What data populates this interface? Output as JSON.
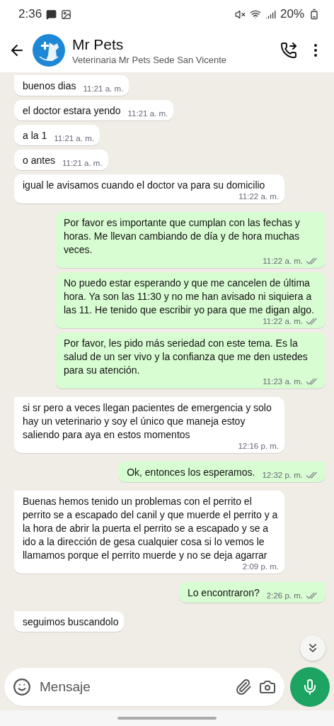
{
  "status_bar": {
    "time": "2:36",
    "battery": "20%"
  },
  "header": {
    "title": "Mr Pets",
    "subtitle": "Veterinaria Mr Pets Sede San Vicente"
  },
  "messages": [
    {
      "kind": "incoming",
      "text": "buenos dias",
      "time": "11:21 a. m."
    },
    {
      "kind": "incoming",
      "text": "el doctor estara yendo",
      "time": "11:21 a. m."
    },
    {
      "kind": "incoming",
      "text": "a la 1",
      "time": "11:21 a. m."
    },
    {
      "kind": "incoming",
      "text": "o antes",
      "time": "11:21 a. m."
    },
    {
      "kind": "incoming",
      "text": "igual le avisamos cuando el doctor va para su domicilio",
      "time": "11:22 a. m."
    },
    {
      "kind": "outgoing",
      "text": "Por favor es importante que cumplan con las fechas y horas. Me llevan cambiando de día y de hora muchas veces.",
      "time": "11:22 a. m."
    },
    {
      "kind": "outgoing",
      "text": "No puedo estar esperando y que me cancelen de última hora. Ya son las 11:30 y no me han avisado ni siquiera a las 11. He tenido que escribir yo para que me digan algo.",
      "time": "11:22 a. m."
    },
    {
      "kind": "outgoing",
      "text": "Por favor, les pido más seriedad con este tema. Es la salud de un ser vivo y la confianza que me den ustedes para su atención.",
      "time": "11:23 a. m."
    },
    {
      "kind": "incoming",
      "text": "si sr pero a veces llegan pacientes de emergencia y solo hay un veterinario y soy el único que maneja estoy saliendo para aya en estos momentos",
      "time": "12:16 p. m."
    },
    {
      "kind": "outgoing",
      "text": "Ok, entonces los esperamos.",
      "time": "12:32 p. m."
    },
    {
      "kind": "incoming",
      "text": "Buenas hemos tenido un problemas con el perrito el perrito se a escapado del canil y que muerde el perrito y a la hora de abrir la puerta el perrito se a escapado y se a ido a la dirección de gesa cualquier cosa si lo vemos le llamamos porque el perrito muerde y no se deja agarrar",
      "time": "2:09 p. m."
    },
    {
      "kind": "outgoing",
      "text": "Lo encontraron?",
      "time": "2:26 p. m."
    },
    {
      "kind": "incoming",
      "text": "seguimos buscandolo"
    }
  ],
  "composer": {
    "placeholder": "Mensaje"
  }
}
